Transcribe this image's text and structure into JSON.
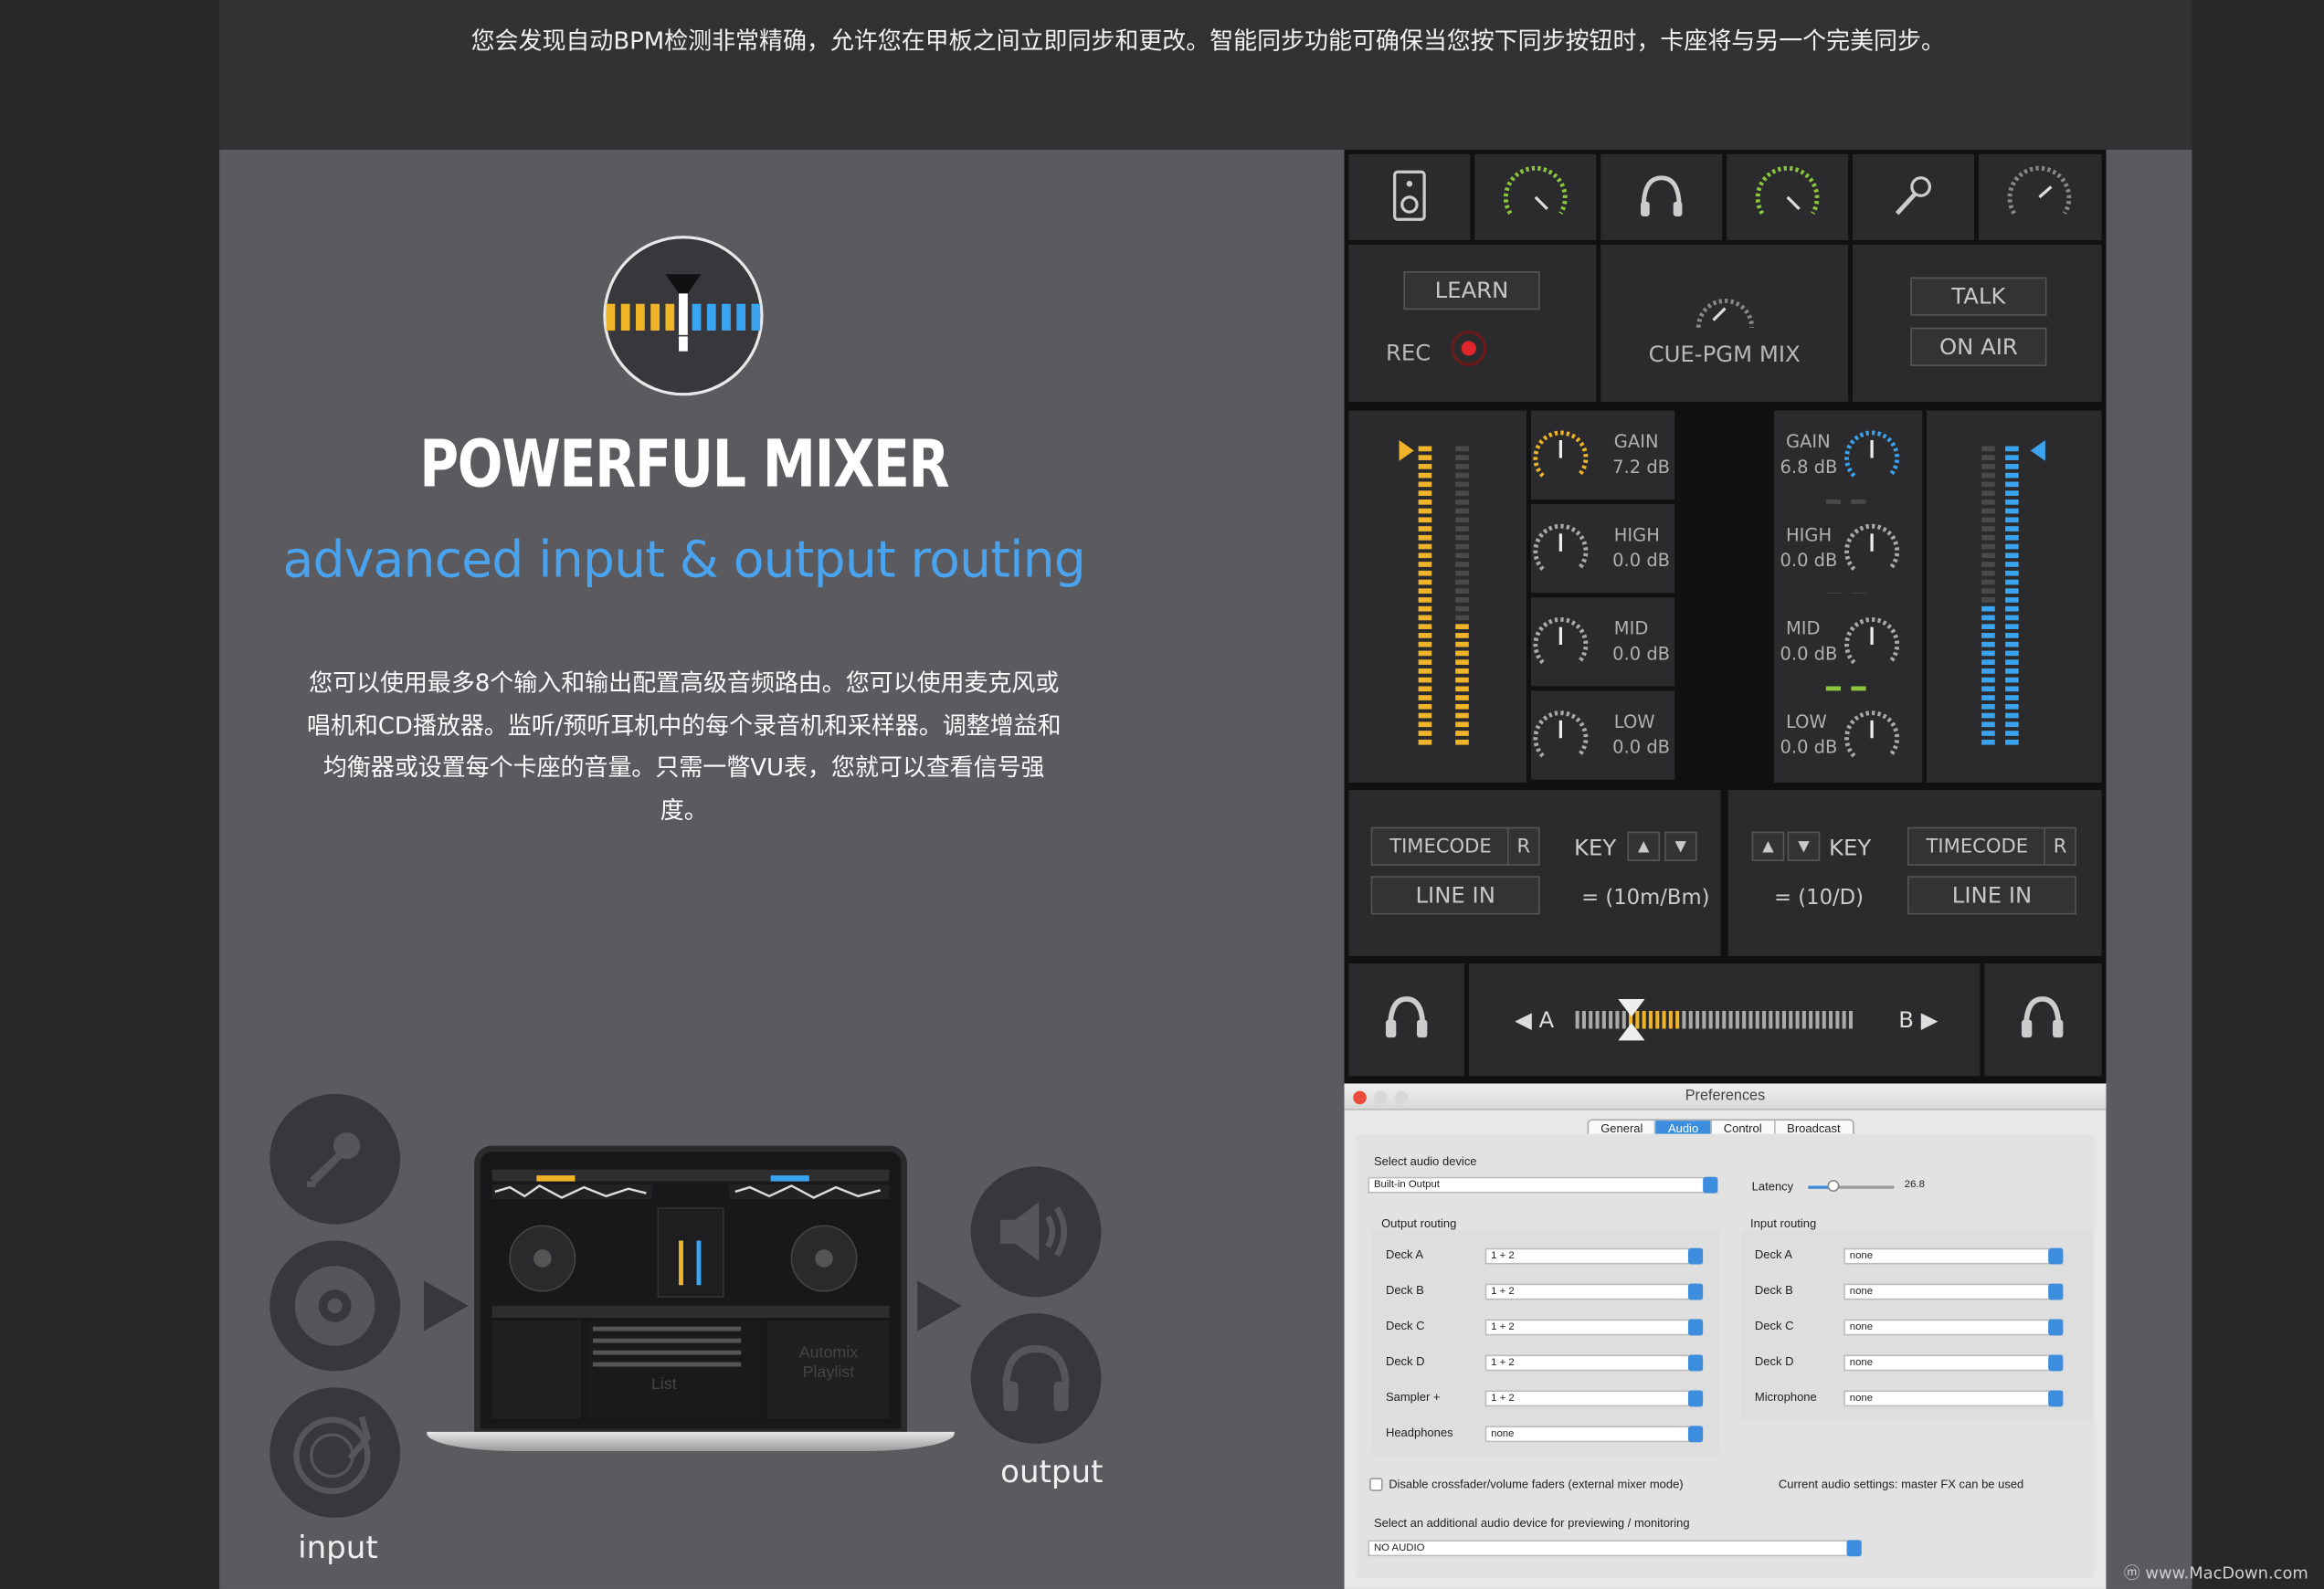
{
  "header": {
    "text": "您会发现自动BPM检测非常精确，允许您在甲板之间立即同步和更改。智能同步功能可确保当您按下同步按钮时，卡座将与另一个完美同步。"
  },
  "hero": {
    "title": "POWERFUL MIXER",
    "subtitle": "advanced input & output routing",
    "description": "您可以使用最多8个输入和输出配置高级音频路由。您可以使用麦克风或唱机和CD播放器。监听/预听耳机中的每个录音机和采样器。调整增益和均衡器或设置每个卡座的音量。只需一瞥VU表，您就可以查看信号强度。"
  },
  "diagram": {
    "input_label": "input",
    "output_label": "output",
    "inputs": [
      "microphone-icon",
      "cd-icon",
      "turntable-icon"
    ],
    "outputs": [
      "speaker-icon",
      "headphones-icon"
    ],
    "laptop_screen_texts": [
      "Automix",
      "Playlist",
      "List"
    ]
  },
  "mixer": {
    "learn": "LEARN",
    "rec": "REC",
    "cue_pgm": "CUE-PGM MIX",
    "talk": "TALK",
    "on_air": "ON AIR",
    "left_eq": [
      {
        "label": "GAIN",
        "value": "7.2 dB"
      },
      {
        "label": "HIGH",
        "value": "0.0 dB"
      },
      {
        "label": "MID",
        "value": "0.0 dB"
      },
      {
        "label": "LOW",
        "value": "0.0 dB"
      }
    ],
    "right_eq": [
      {
        "label": "GAIN",
        "value": "6.8 dB"
      },
      {
        "label": "HIGH",
        "value": "0.0 dB"
      },
      {
        "label": "MID",
        "value": "0.0 dB"
      },
      {
        "label": "LOW",
        "value": "0.0 dB"
      }
    ],
    "deck_left": {
      "timecode": "TIMECODE",
      "r": "R",
      "line_in": "LINE IN",
      "key": "KEY",
      "key_value": "= (10m/Bm)"
    },
    "deck_right": {
      "timecode": "TIMECODE",
      "r": "R",
      "line_in": "LINE IN",
      "key": "KEY",
      "key_value": "= (10/D)"
    },
    "crossfader": {
      "a": "A",
      "b": "B",
      "position": 0.2
    },
    "colors": {
      "yellow": "#f0b429",
      "blue": "#3ba4f0",
      "green": "#8cc63f"
    }
  },
  "prefs": {
    "title": "Preferences",
    "tabs": [
      "General",
      "Audio",
      "Control",
      "Broadcast"
    ],
    "active_tab": "Audio",
    "select_device_label": "Select audio device",
    "device": "Built-in Output",
    "latency_label": "Latency",
    "latency_value": "26.8",
    "output_routing_label": "Output routing",
    "input_routing_label": "Input routing",
    "output_rows": [
      {
        "name": "Deck A",
        "value": "1 + 2"
      },
      {
        "name": "Deck B",
        "value": "1 + 2"
      },
      {
        "name": "Deck C",
        "value": "1 + 2"
      },
      {
        "name": "Deck D",
        "value": "1 + 2"
      },
      {
        "name": "Sampler +",
        "value": "1 + 2"
      },
      {
        "name": "Headphones",
        "value": "none"
      }
    ],
    "input_rows": [
      {
        "name": "Deck A",
        "value": "none"
      },
      {
        "name": "Deck B",
        "value": "none"
      },
      {
        "name": "Deck C",
        "value": "none"
      },
      {
        "name": "Deck D",
        "value": "none"
      },
      {
        "name": "Microphone",
        "value": "none"
      }
    ],
    "disable_faders": "Disable crossfader/volume faders (external mixer mode)",
    "current_settings": "Current audio settings: master FX can be used",
    "additional_label": "Select an additional audio device for previewing / monitoring",
    "additional_value": "NO AUDIO"
  },
  "watermark": "www.MacDown.com"
}
